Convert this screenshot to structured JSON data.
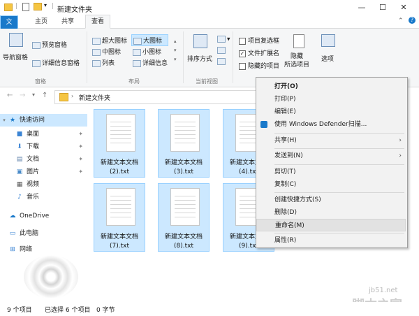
{
  "window": {
    "title": "新建文件夹",
    "minimize": "—",
    "maximize": "☐",
    "close": "✕"
  },
  "tabs": [
    "文件",
    "主页",
    "共享",
    "查看"
  ],
  "ribbon": {
    "nav_pane": "导航窗格",
    "preview_pane": "预览窗格",
    "details_pane": "详细信息窗格",
    "pane_group": "窗格",
    "layout": [
      "超大图标",
      "大图标",
      "中图标",
      "小图标",
      "列表",
      "详细信息"
    ],
    "layout_group": "布局",
    "sort": "排序方式",
    "current_view_group": "当前视图",
    "checkbox_items": "项目复选框",
    "file_ext": "文件扩展名",
    "hidden_items": "隐藏的项目",
    "hide_selected": [
      "隐藏",
      "所选项目"
    ],
    "options": "选项"
  },
  "address": {
    "path": "新建文件夹"
  },
  "nav": {
    "quick_access": "快速访问",
    "items": [
      "桌面",
      "下载",
      "文档",
      "图片",
      "视频",
      "音乐"
    ],
    "onedrive": "OneDrive",
    "this_pc": "此电脑",
    "network": "网络"
  },
  "files": [
    {
      "line1": "新建文本文档",
      "line2": "(2).txt"
    },
    {
      "line1": "新建文本文档",
      "line2": "(3).txt"
    },
    {
      "line1": "新建文本文档",
      "line2": "(4).txt"
    },
    {
      "line1": "新建文本文档",
      "line2": "(7).txt"
    },
    {
      "line1": "新建文本文档",
      "line2": "(8).txt"
    },
    {
      "line1": "新建文本文档",
      "line2": "(9).txt"
    }
  ],
  "context_menu": [
    "打开(O)",
    "打印(P)",
    "编辑(E)",
    "使用 Windows Defender扫描...",
    "共享(H)",
    "发送到(N)",
    "剪切(T)",
    "复制(C)",
    "创建快捷方式(S)",
    "删除(D)",
    "重命名(M)",
    "属性(R)"
  ],
  "status": {
    "count": "9 个项目",
    "selected": "已选择 6 个项目",
    "size": "0 字节"
  },
  "watermark": {
    "url": "jb51.net",
    "name": "脚本之家"
  },
  "colors": {
    "accent": "#1979ca",
    "selection": "#cce8ff",
    "selection_border": "#99d1ff",
    "menu_bg": "#f2f2f2",
    "highlight": "#e2e2e2"
  }
}
